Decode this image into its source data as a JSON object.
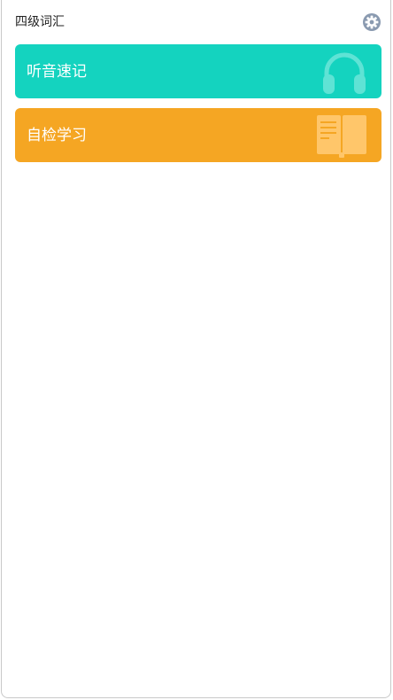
{
  "header": {
    "title": "四级词汇"
  },
  "cards": [
    {
      "label": "听音速记",
      "icon": "headphones-icon",
      "color": "#14d3bf"
    },
    {
      "label": "自检学习",
      "icon": "book-icon",
      "color": "#f5a623"
    }
  ],
  "colors": {
    "settings_icon": "#8a9ab0",
    "headphones_icon": "#5fe3d5",
    "book_icon": "#ffc66a"
  }
}
